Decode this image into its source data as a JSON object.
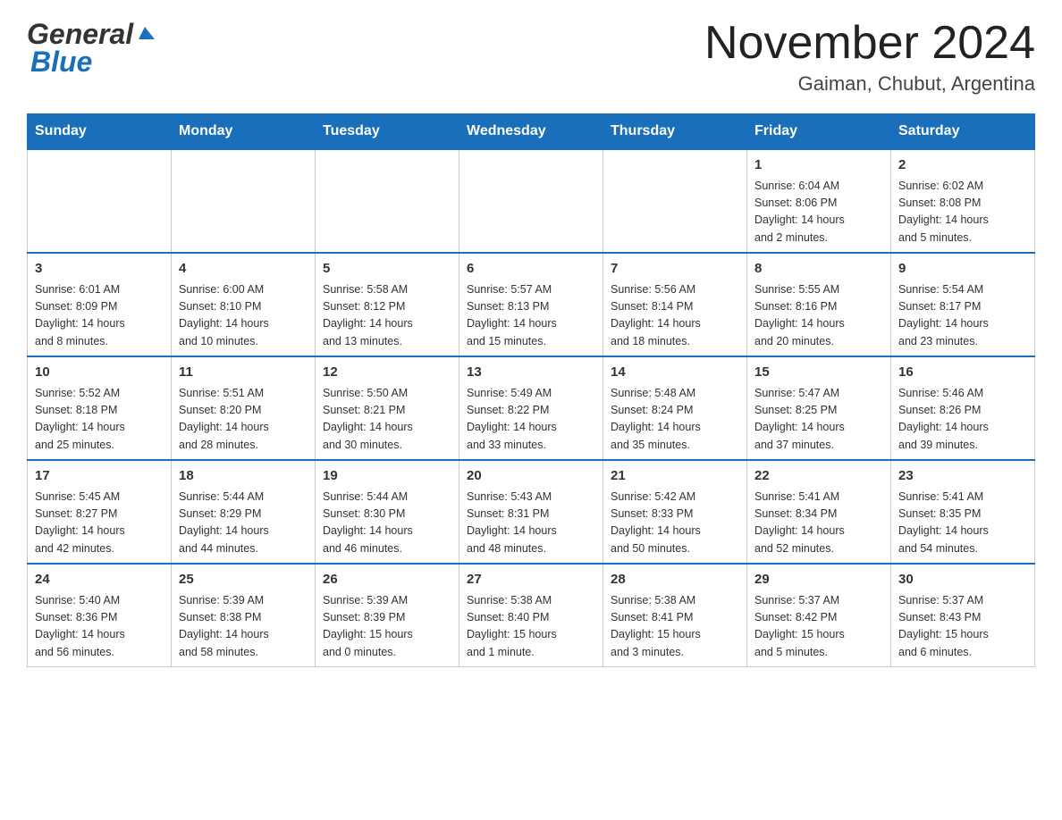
{
  "header": {
    "logo_general": "General",
    "logo_blue": "Blue",
    "month_year": "November 2024",
    "location": "Gaiman, Chubut, Argentina"
  },
  "weekdays": [
    "Sunday",
    "Monday",
    "Tuesday",
    "Wednesday",
    "Thursday",
    "Friday",
    "Saturday"
  ],
  "weeks": [
    [
      {
        "day": "",
        "info": ""
      },
      {
        "day": "",
        "info": ""
      },
      {
        "day": "",
        "info": ""
      },
      {
        "day": "",
        "info": ""
      },
      {
        "day": "",
        "info": ""
      },
      {
        "day": "1",
        "info": "Sunrise: 6:04 AM\nSunset: 8:06 PM\nDaylight: 14 hours\nand 2 minutes."
      },
      {
        "day": "2",
        "info": "Sunrise: 6:02 AM\nSunset: 8:08 PM\nDaylight: 14 hours\nand 5 minutes."
      }
    ],
    [
      {
        "day": "3",
        "info": "Sunrise: 6:01 AM\nSunset: 8:09 PM\nDaylight: 14 hours\nand 8 minutes."
      },
      {
        "day": "4",
        "info": "Sunrise: 6:00 AM\nSunset: 8:10 PM\nDaylight: 14 hours\nand 10 minutes."
      },
      {
        "day": "5",
        "info": "Sunrise: 5:58 AM\nSunset: 8:12 PM\nDaylight: 14 hours\nand 13 minutes."
      },
      {
        "day": "6",
        "info": "Sunrise: 5:57 AM\nSunset: 8:13 PM\nDaylight: 14 hours\nand 15 minutes."
      },
      {
        "day": "7",
        "info": "Sunrise: 5:56 AM\nSunset: 8:14 PM\nDaylight: 14 hours\nand 18 minutes."
      },
      {
        "day": "8",
        "info": "Sunrise: 5:55 AM\nSunset: 8:16 PM\nDaylight: 14 hours\nand 20 minutes."
      },
      {
        "day": "9",
        "info": "Sunrise: 5:54 AM\nSunset: 8:17 PM\nDaylight: 14 hours\nand 23 minutes."
      }
    ],
    [
      {
        "day": "10",
        "info": "Sunrise: 5:52 AM\nSunset: 8:18 PM\nDaylight: 14 hours\nand 25 minutes."
      },
      {
        "day": "11",
        "info": "Sunrise: 5:51 AM\nSunset: 8:20 PM\nDaylight: 14 hours\nand 28 minutes."
      },
      {
        "day": "12",
        "info": "Sunrise: 5:50 AM\nSunset: 8:21 PM\nDaylight: 14 hours\nand 30 minutes."
      },
      {
        "day": "13",
        "info": "Sunrise: 5:49 AM\nSunset: 8:22 PM\nDaylight: 14 hours\nand 33 minutes."
      },
      {
        "day": "14",
        "info": "Sunrise: 5:48 AM\nSunset: 8:24 PM\nDaylight: 14 hours\nand 35 minutes."
      },
      {
        "day": "15",
        "info": "Sunrise: 5:47 AM\nSunset: 8:25 PM\nDaylight: 14 hours\nand 37 minutes."
      },
      {
        "day": "16",
        "info": "Sunrise: 5:46 AM\nSunset: 8:26 PM\nDaylight: 14 hours\nand 39 minutes."
      }
    ],
    [
      {
        "day": "17",
        "info": "Sunrise: 5:45 AM\nSunset: 8:27 PM\nDaylight: 14 hours\nand 42 minutes."
      },
      {
        "day": "18",
        "info": "Sunrise: 5:44 AM\nSunset: 8:29 PM\nDaylight: 14 hours\nand 44 minutes."
      },
      {
        "day": "19",
        "info": "Sunrise: 5:44 AM\nSunset: 8:30 PM\nDaylight: 14 hours\nand 46 minutes."
      },
      {
        "day": "20",
        "info": "Sunrise: 5:43 AM\nSunset: 8:31 PM\nDaylight: 14 hours\nand 48 minutes."
      },
      {
        "day": "21",
        "info": "Sunrise: 5:42 AM\nSunset: 8:33 PM\nDaylight: 14 hours\nand 50 minutes."
      },
      {
        "day": "22",
        "info": "Sunrise: 5:41 AM\nSunset: 8:34 PM\nDaylight: 14 hours\nand 52 minutes."
      },
      {
        "day": "23",
        "info": "Sunrise: 5:41 AM\nSunset: 8:35 PM\nDaylight: 14 hours\nand 54 minutes."
      }
    ],
    [
      {
        "day": "24",
        "info": "Sunrise: 5:40 AM\nSunset: 8:36 PM\nDaylight: 14 hours\nand 56 minutes."
      },
      {
        "day": "25",
        "info": "Sunrise: 5:39 AM\nSunset: 8:38 PM\nDaylight: 14 hours\nand 58 minutes."
      },
      {
        "day": "26",
        "info": "Sunrise: 5:39 AM\nSunset: 8:39 PM\nDaylight: 15 hours\nand 0 minutes."
      },
      {
        "day": "27",
        "info": "Sunrise: 5:38 AM\nSunset: 8:40 PM\nDaylight: 15 hours\nand 1 minute."
      },
      {
        "day": "28",
        "info": "Sunrise: 5:38 AM\nSunset: 8:41 PM\nDaylight: 15 hours\nand 3 minutes."
      },
      {
        "day": "29",
        "info": "Sunrise: 5:37 AM\nSunset: 8:42 PM\nDaylight: 15 hours\nand 5 minutes."
      },
      {
        "day": "30",
        "info": "Sunrise: 5:37 AM\nSunset: 8:43 PM\nDaylight: 15 hours\nand 6 minutes."
      }
    ]
  ]
}
